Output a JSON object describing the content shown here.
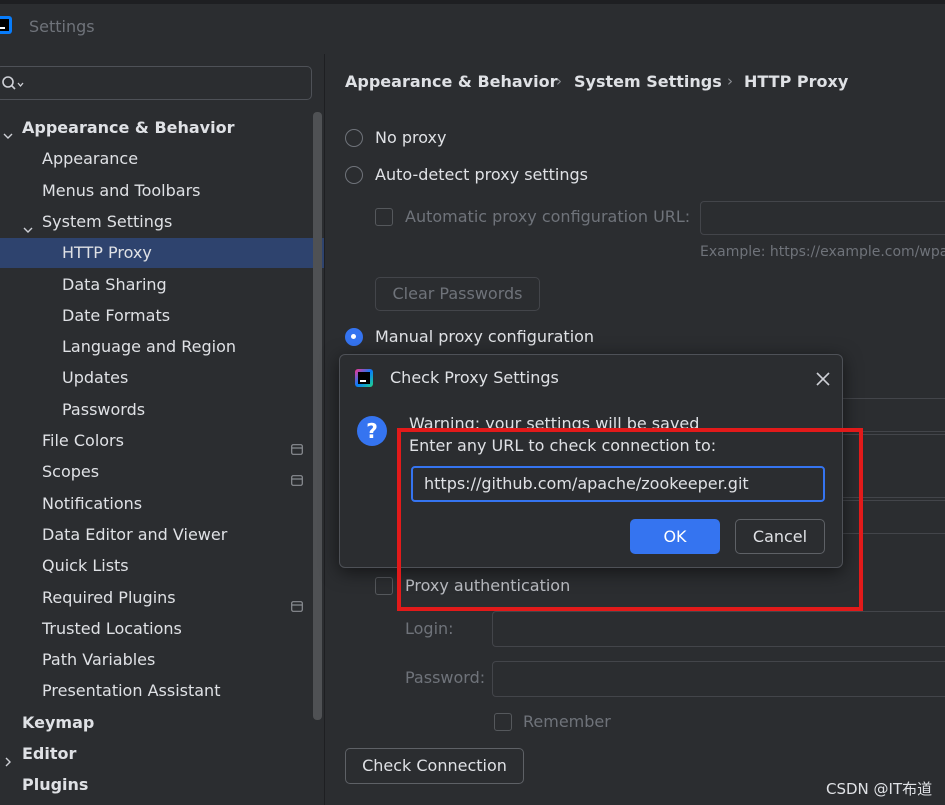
{
  "window": {
    "title": "Settings"
  },
  "search": {
    "placeholder": ""
  },
  "sidebar": {
    "items": [
      {
        "label": "Appearance & Behavior",
        "level": 0,
        "expanded": true
      },
      {
        "label": "Appearance",
        "level": 1
      },
      {
        "label": "Menus and Toolbars",
        "level": 1
      },
      {
        "label": "System Settings",
        "level": 1,
        "expanded": true
      },
      {
        "label": "HTTP Proxy",
        "level": 2,
        "selected": true
      },
      {
        "label": "Data Sharing",
        "level": 2
      },
      {
        "label": "Date Formats",
        "level": 2
      },
      {
        "label": "Language and Region",
        "level": 2
      },
      {
        "label": "Updates",
        "level": 2
      },
      {
        "label": "Passwords",
        "level": 2
      },
      {
        "label": "File Colors",
        "level": 1
      },
      {
        "label": "Scopes",
        "level": 1
      },
      {
        "label": "Notifications",
        "level": 1
      },
      {
        "label": "Data Editor and Viewer",
        "level": 1
      },
      {
        "label": "Quick Lists",
        "level": 1
      },
      {
        "label": "Required Plugins",
        "level": 1
      },
      {
        "label": "Trusted Locations",
        "level": 1
      },
      {
        "label": "Path Variables",
        "level": 1
      },
      {
        "label": "Presentation Assistant",
        "level": 1
      },
      {
        "label": "Keymap",
        "level": 0
      },
      {
        "label": "Editor",
        "level": 0,
        "collapsed": true
      },
      {
        "label": "Plugins",
        "level": 0
      }
    ]
  },
  "breadcrumb": [
    "Appearance & Behavior",
    "System Settings",
    "HTTP Proxy"
  ],
  "proxy": {
    "no_proxy": "No proxy",
    "auto_detect": "Auto-detect proxy settings",
    "auto_config_url": "Automatic proxy configuration URL:",
    "example": "Example: https://example.com/wpa",
    "clear_passwords": "Clear Passwords",
    "manual": "Manual proxy configuration",
    "proxy_auth": "Proxy authentication",
    "login": "Login:",
    "password": "Password:",
    "remember": "Remember",
    "check_connection": "Check Connection",
    "selected": "manual"
  },
  "dialog": {
    "title": "Check Proxy Settings",
    "warning": "Warning: your settings will be saved",
    "prompt": "Enter any URL to check connection to:",
    "url_value": "https://github.com/apache/zookeeper.git",
    "ok": "OK",
    "cancel": "Cancel"
  },
  "watermark": "CSDN @IT布道",
  "colors": {
    "accent": "#3574f0",
    "selection": "#2e436e",
    "highlight_box": "#e21a1a",
    "background": "#2b2d30"
  }
}
